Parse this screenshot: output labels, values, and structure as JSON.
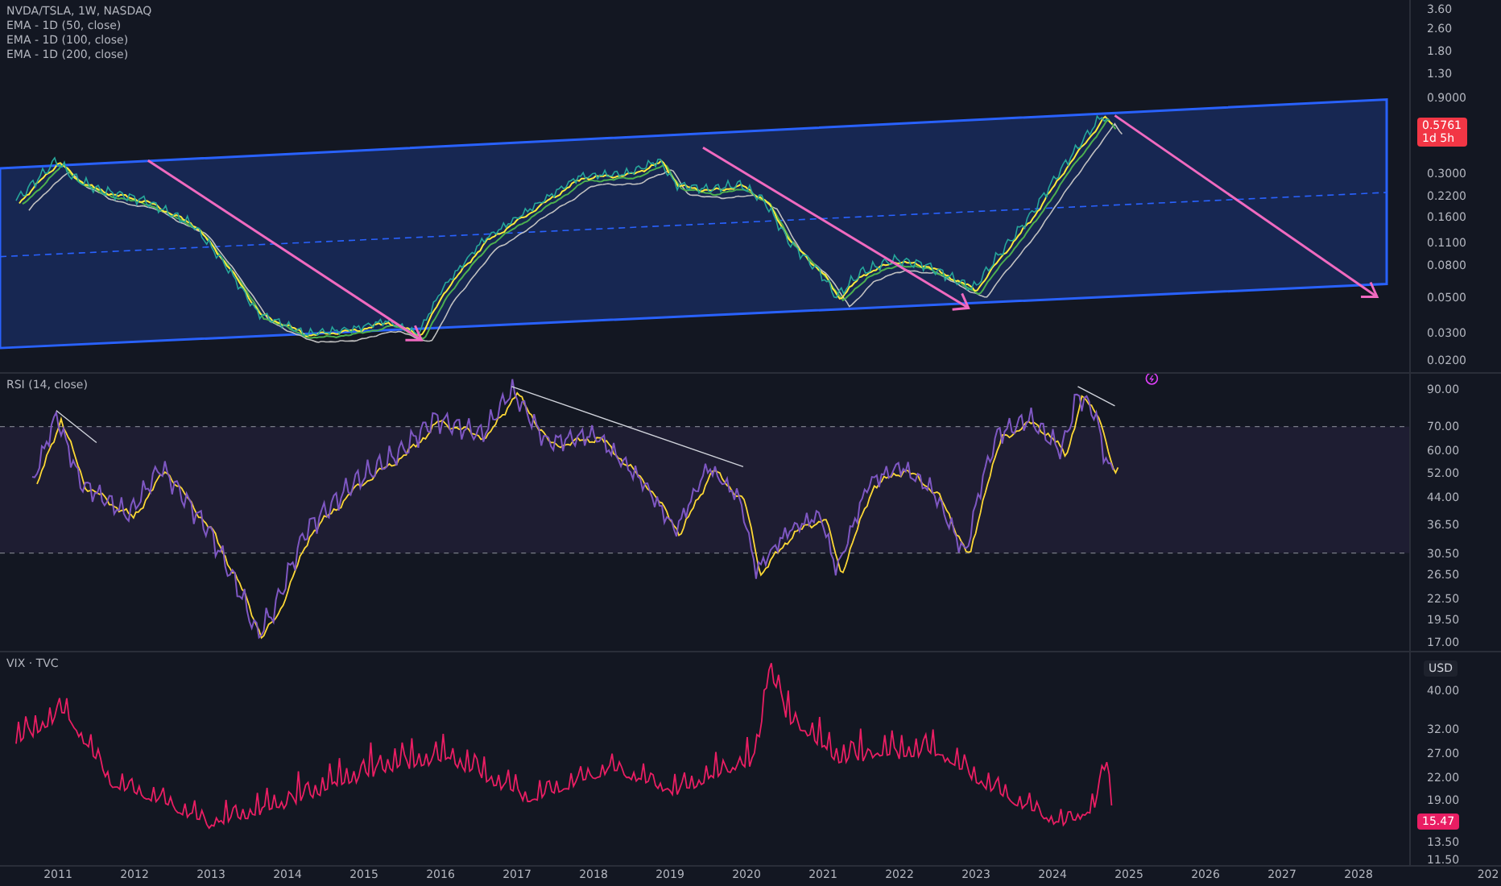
{
  "legend": {
    "symbol": "NVDA/TSLA, 1W, NASDAQ",
    "indicators": [
      "EMA - 1D (50, close)",
      "EMA - 1D (100, close)",
      "EMA - 1D (200, close)"
    ]
  },
  "price_pane": {
    "axis_ticks": [
      "3.60",
      "2.60",
      "1.80",
      "1.30",
      "0.9000",
      "0.3000",
      "0.2200",
      "0.1600",
      "0.1100",
      "0.0800",
      "0.0500",
      "0.0300",
      "0.0200"
    ],
    "last_price": {
      "value": "0.5761",
      "countdown": "1d 5h"
    }
  },
  "rsi_pane": {
    "title": "RSI (14, close)",
    "axis_ticks": [
      "90.00",
      "70.00",
      "60.00",
      "52.00",
      "44.00",
      "36.50",
      "30.50",
      "26.50",
      "22.50",
      "19.50",
      "17.00"
    ]
  },
  "vix_pane": {
    "title": "VIX · TVC",
    "currency": "USD",
    "axis_ticks": [
      "40.00",
      "32.00",
      "27.00",
      "22.00",
      "19.00",
      "13.50",
      "11.50"
    ],
    "last_value": "15.47"
  },
  "time_axis": [
    "2011",
    "2012",
    "2013",
    "2014",
    "2015",
    "2016",
    "2017",
    "2018",
    "2019",
    "2020",
    "2021",
    "2022",
    "2023",
    "2024",
    "2025",
    "2026",
    "2027",
    "2028",
    "202"
  ]
}
